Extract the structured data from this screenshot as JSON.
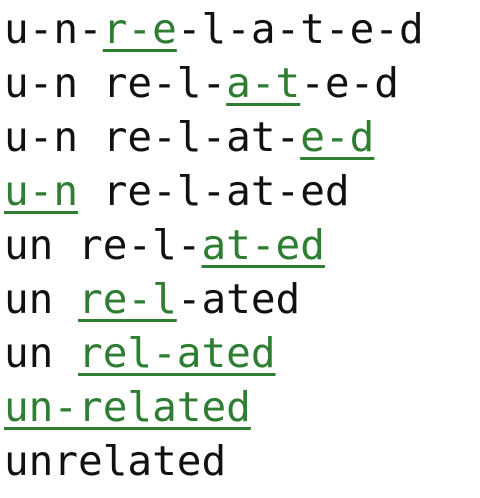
{
  "steps": [
    [
      {
        "t": "u-n-"
      },
      {
        "t": "r-e",
        "hl": true
      },
      {
        "t": "-l-a-t-e-d"
      }
    ],
    [
      {
        "t": "u-n re-l-"
      },
      {
        "t": "a-t",
        "hl": true
      },
      {
        "t": "-e-d"
      }
    ],
    [
      {
        "t": "u-n re-l-at-"
      },
      {
        "t": "e-d",
        "hl": true
      }
    ],
    [
      {
        "t": "u-n",
        "hl": true
      },
      {
        "t": " re-l-at-ed"
      }
    ],
    [
      {
        "t": "un re-l-"
      },
      {
        "t": "at-ed",
        "hl": true
      }
    ],
    [
      {
        "t": "un "
      },
      {
        "t": "re-l",
        "hl": true
      },
      {
        "t": "-ated"
      }
    ],
    [
      {
        "t": "un "
      },
      {
        "t": "rel-ated",
        "hl": true
      }
    ],
    [
      {
        "t": "un-related",
        "hl": true
      }
    ],
    [
      {
        "t": "unrelated"
      }
    ]
  ],
  "colors": {
    "text": "#111111",
    "merge_highlight": "#2e7d32",
    "background": "#ffffff"
  }
}
